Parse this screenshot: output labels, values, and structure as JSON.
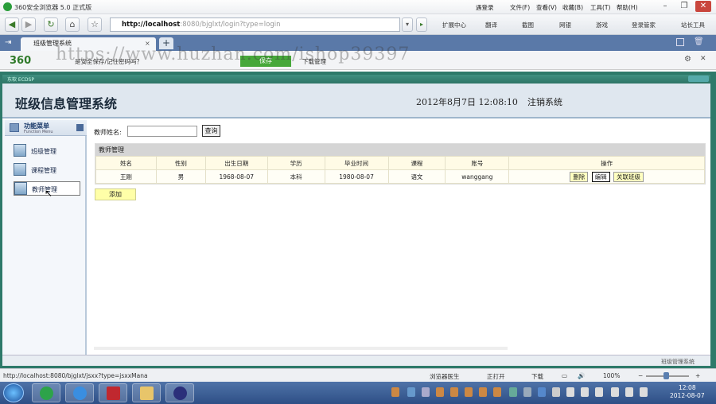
{
  "browser": {
    "title": "360安全浏览器 5.0 正式版",
    "menus": [
      "遇登录",
      "文件(F)",
      "查看(V)",
      "收藏(B)",
      "工具(T)",
      "帮助(H)"
    ],
    "url_host": "http://localhost",
    "url_rest": ":8080/bjglxt/login?type=login",
    "tools": [
      "扩展中心",
      "翻译",
      "截图",
      "网银",
      "游戏",
      "登录管家",
      "站长工具"
    ],
    "tab_title": "班级管理系统",
    "toolbar_brand": "360",
    "toolbar_msg": "是安全保存/记住密码吗？",
    "toolbar_btn": "保存",
    "toolbar_download": "下载管理",
    "watermark": "https://www.huzhan.com/ishop39397"
  },
  "app": {
    "caption": "东软 ECDSP",
    "title": "班级信息管理系统",
    "datetime": "2012年8月7日  12:08:10",
    "logout": "注销系统",
    "menu_title": "功能菜单",
    "menu_subtitle": "Function Menu",
    "menu_items": [
      "班级管理",
      "课程管理",
      "教师管理"
    ],
    "search_label": "教师姓名:",
    "search_value": "",
    "search_button": "查询",
    "table_caption": "教师管理",
    "columns": [
      "姓名",
      "性别",
      "出生日期",
      "学历",
      "毕业时间",
      "课程",
      "账号",
      "操作"
    ],
    "rows": [
      {
        "name": "王刚",
        "gender": "男",
        "birth": "1968-08-07",
        "edu": "本科",
        "grad": "1980-08-07",
        "course": "语文",
        "account": "wanggang"
      }
    ],
    "actions": [
      "删除",
      "编辑",
      "关联班级"
    ],
    "add_button": "添加",
    "footer_text": "班级管理系统"
  },
  "status": {
    "url": "http://localhost:8080/bjglxt/jsxx?type=jsxxMana",
    "items": [
      "浏览器医生",
      "正打开",
      "下载"
    ],
    "zoom": "100%"
  },
  "taskbar": {
    "time": "12:08",
    "date": "2012-08-07"
  }
}
